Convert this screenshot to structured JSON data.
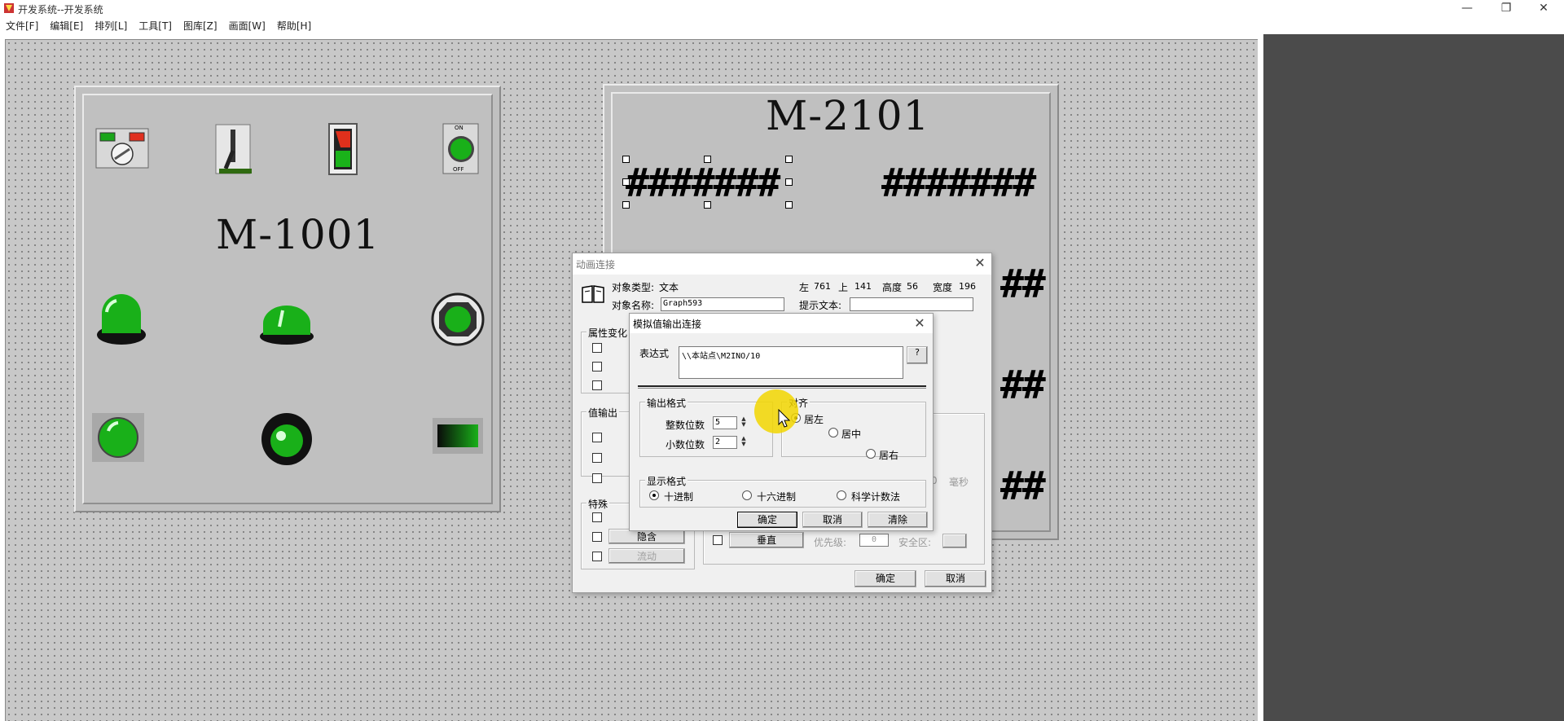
{
  "window": {
    "title": "开发系统--开发系统",
    "controls": [
      "—",
      "❐",
      "✕"
    ]
  },
  "menu": [
    "文件[F]",
    "编辑[E]",
    "排列[L]",
    "工具[T]",
    "图库[Z]",
    "画面[W]",
    "帮助[H]"
  ],
  "panel_left": {
    "label": "M-1001",
    "switch_on": "ON",
    "switch_off": "OFF"
  },
  "panel_right": {
    "label": "M-2101",
    "hash_selected": "#######",
    "hash_right": "#######",
    "hash_partial_1": "##",
    "hash_partial_2": "##",
    "hash_partial_3": "##"
  },
  "anim_dialog": {
    "title": "动画连接",
    "object_type_label": "对象类型:",
    "object_type_value": "文本",
    "left_label": "左",
    "left_value": "761",
    "top_label": "上",
    "top_value": "141",
    "height_label": "高度",
    "height_value": "56",
    "width_label": "宽度",
    "width_value": "196",
    "object_name_label": "对象名称:",
    "object_name_value": "Graph593",
    "hint_label": "提示文本:",
    "hint_value": "",
    "group_attr": "属性变化",
    "group_value_output": "值输出",
    "group_special": "特殊",
    "btn_hide": "隐含",
    "btn_flow": "流动",
    "btn_vertical": "垂直",
    "priority_label": "优先级:",
    "priority_value": "0",
    "security_label": "安全区:",
    "ms_partial": "0",
    "ms_label": "毫秒",
    "ok": "确定",
    "cancel": "取消"
  },
  "analog_dialog": {
    "title": "模拟值输出连接",
    "expr_label": "表达式",
    "expr_value": "\\\\本站点\\M2INO/10",
    "help_btn": "?",
    "format_group": "输出格式",
    "int_digits_label": "整数位数",
    "int_digits_value": "5",
    "dec_digits_label": "小数位数",
    "dec_digits_value": "2",
    "align_group": "对齐",
    "align_left": "居左",
    "align_center": "居中",
    "align_right": "居右",
    "display_group": "显示格式",
    "fmt_dec": "十进制",
    "fmt_hex": "十六进制",
    "fmt_sci": "科学计数法",
    "ok": "确定",
    "cancel": "取消",
    "clear": "清除"
  },
  "colors": {
    "canvas": "#c8c8c8",
    "panel": "#c0c0c0",
    "lamp_green": "#19b019",
    "dark_area": "#4b4b4b",
    "cursor_highlight": "#f2d600"
  }
}
